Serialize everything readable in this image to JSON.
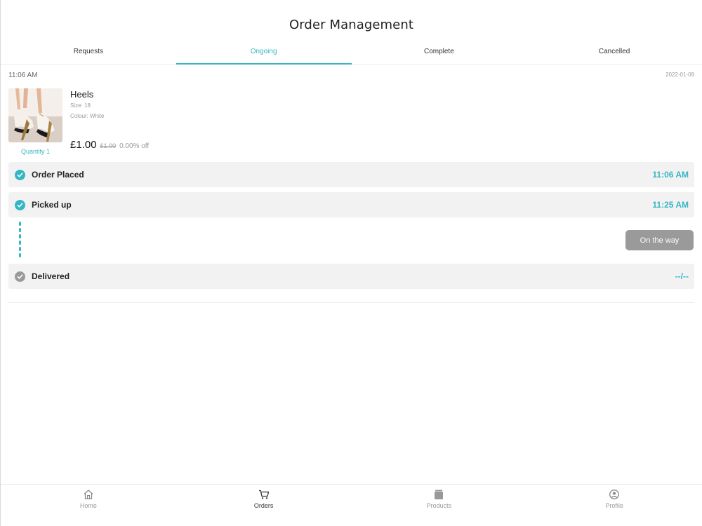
{
  "header": {
    "title": "Order Management"
  },
  "tabs": [
    {
      "label": "Requests",
      "active": false
    },
    {
      "label": "Ongoing",
      "active": true
    },
    {
      "label": "Complete",
      "active": false
    },
    {
      "label": "Cancelled",
      "active": false
    }
  ],
  "order": {
    "time": "11:06 AM",
    "date": "2022-01-09",
    "product": {
      "name": "Heels",
      "size": "Size: 18",
      "colour": "Colour: White",
      "quantity": "Quantity 1",
      "price": "£1.00",
      "old_price": "£1.00",
      "discount": "0.00% off",
      "image": "heels-photo"
    }
  },
  "steps": [
    {
      "label": "Order Placed",
      "time": "11:06 AM",
      "status": "done"
    },
    {
      "label": "Picked up",
      "time": "11:25 AM",
      "status": "done"
    },
    {
      "label": "Delivered",
      "time": "--/--",
      "status": "pending"
    }
  ],
  "on_the_way_button": "On the way",
  "bottom_nav": [
    {
      "label": "Home",
      "icon": "home-icon",
      "active": false
    },
    {
      "label": "Orders",
      "icon": "cart-icon",
      "active": true
    },
    {
      "label": "Products",
      "icon": "box-icon",
      "active": false
    },
    {
      "label": "Profile",
      "icon": "profile-icon",
      "active": false
    }
  ],
  "colors": {
    "accent": "#35b6c4",
    "step_bg": "#f2f2f2",
    "pending": "#9a9a9a"
  }
}
